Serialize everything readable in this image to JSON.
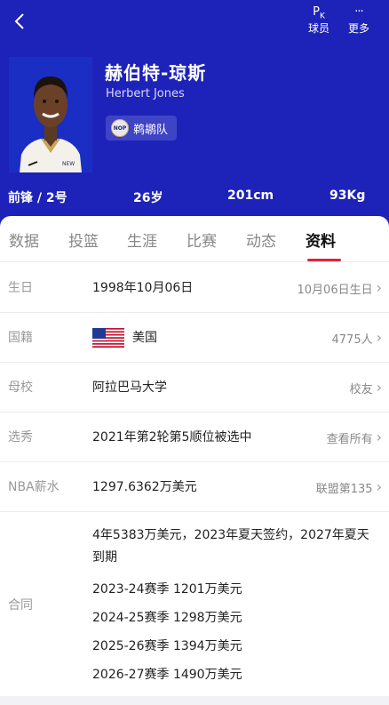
{
  "header": {
    "back_icon": "chevron-left-icon",
    "actions": [
      {
        "icon": "pk-icon",
        "glyph_main": "P",
        "glyph_sub": "K",
        "label": "球员"
      },
      {
        "icon": "more-icon",
        "glyph": "···",
        "label": "更多"
      }
    ],
    "background_color": "#1d22b8"
  },
  "player": {
    "name_cn": "赫伯特-琼斯",
    "name_en": "Herbert Jones",
    "team": "鹈鹕队",
    "team_logo_text": "NOP",
    "position_number": "前锋 / 2号",
    "age": "26岁",
    "height": "201cm",
    "weight": "93Kg"
  },
  "tabs": [
    {
      "label": "数据",
      "active": false
    },
    {
      "label": "投篮",
      "active": false
    },
    {
      "label": "生涯",
      "active": false
    },
    {
      "label": "比赛",
      "active": false
    },
    {
      "label": "动态",
      "active": false
    },
    {
      "label": "资料",
      "active": true
    }
  ],
  "accent_color": "#e0243a",
  "info_rows": [
    {
      "label": "生日",
      "value": "1998年10月06日",
      "action": "10月06日生日"
    },
    {
      "label": "国籍",
      "value": "美国",
      "action": "4775人",
      "flag": "us-flag-icon"
    },
    {
      "label": "母校",
      "value": "阿拉巴马大学",
      "action": "校友"
    },
    {
      "label": "选秀",
      "value": "2021年第2轮第5顺位被选中",
      "action": "查看所有"
    },
    {
      "label": "NBA薪水",
      "value": "1297.6362万美元",
      "action": "联盟第135"
    }
  ],
  "contract": {
    "label": "合同",
    "summary": "4年5383万美元，2023年夏天签约，2027年夏天到期",
    "seasons": [
      "2023-24赛季 1201万美元",
      "2024-25赛季 1298万美元",
      "2025-26赛季 1394万美元",
      "2026-27赛季 1490万美元"
    ]
  }
}
